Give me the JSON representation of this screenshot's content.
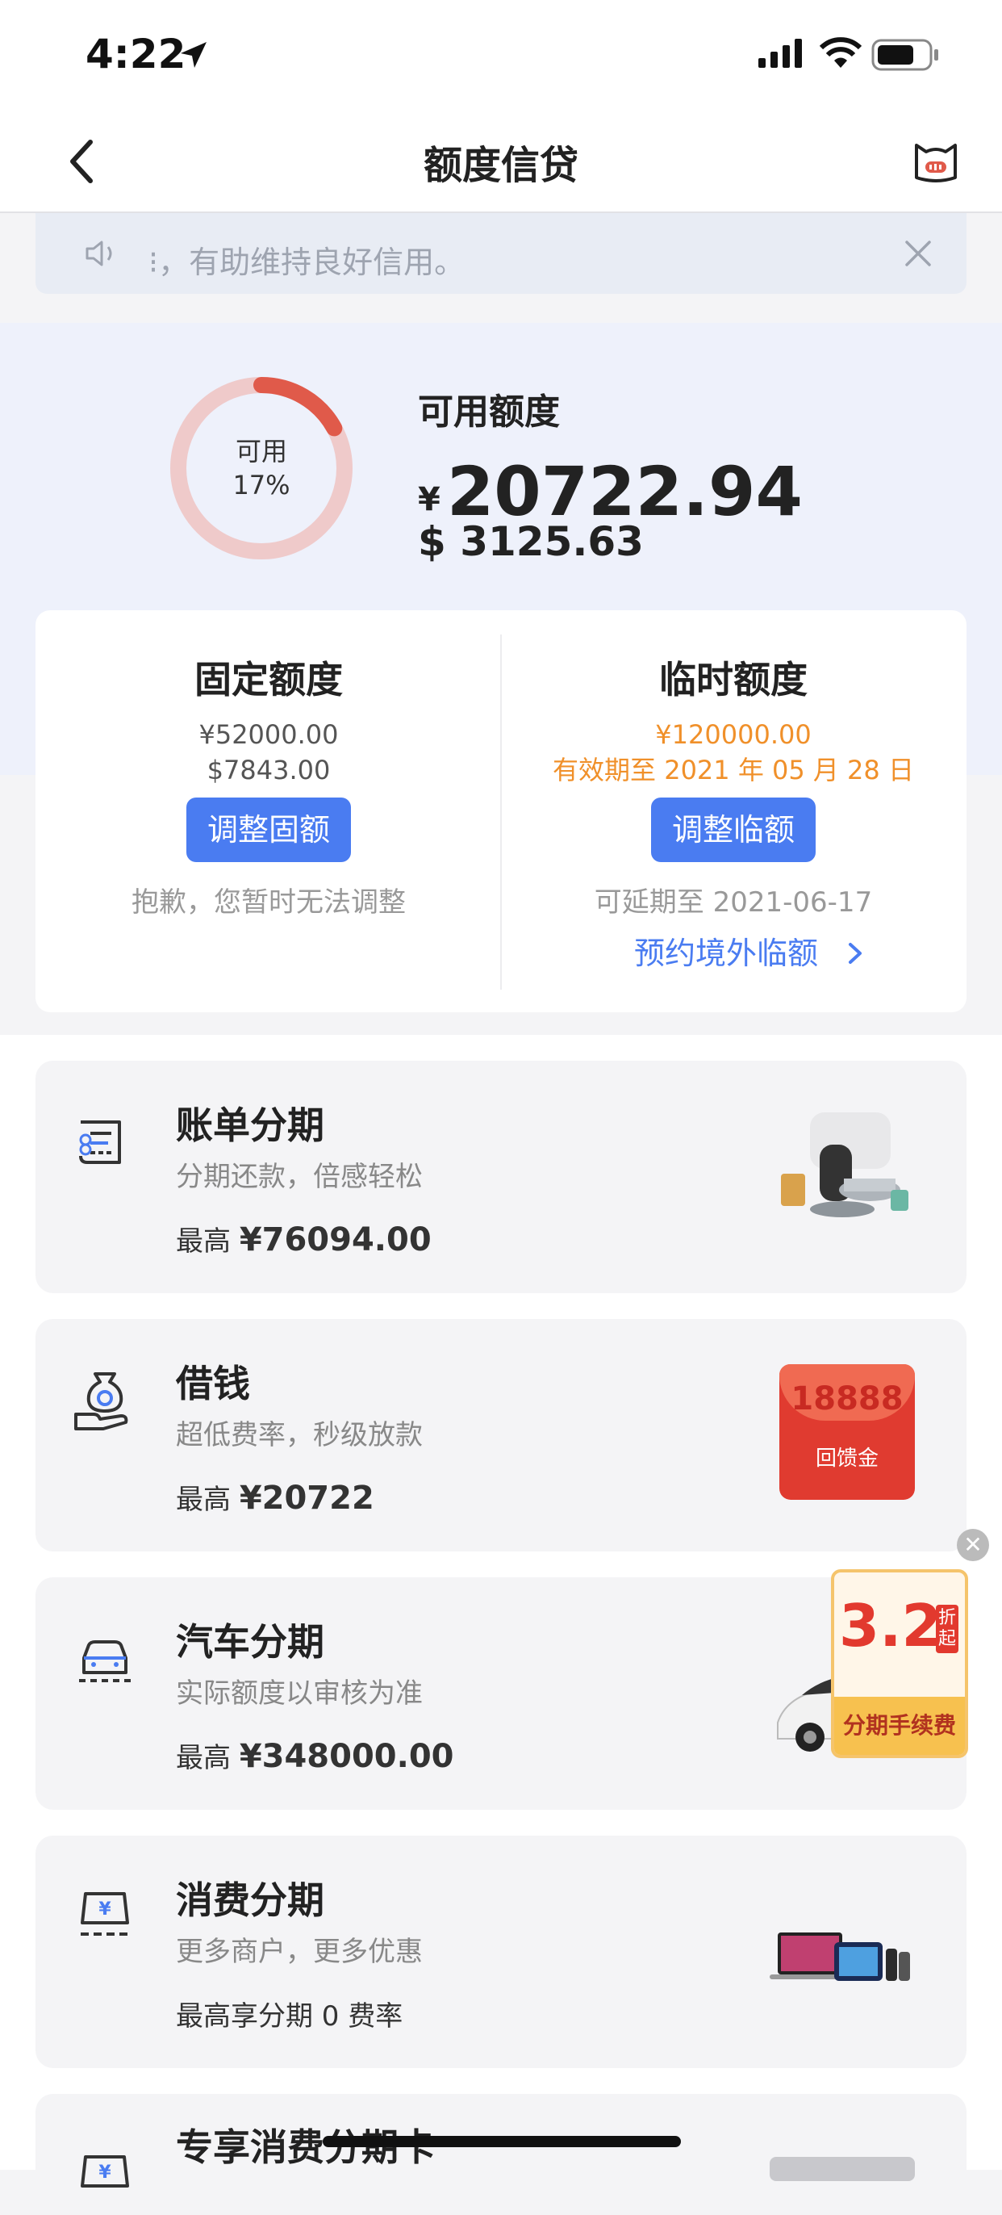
{
  "status_bar": {
    "time": "4:22"
  },
  "header": {
    "title": "额度信贷"
  },
  "notice": {
    "text": "⁝，有助维持良好信用。"
  },
  "summary": {
    "ring_label": "可用",
    "ring_percent": "17%",
    "ring_fraction": 0.17,
    "available_label": "可用额度",
    "cny_symbol": "¥",
    "cny_amount": "20722.94",
    "usd_amount": "$ 3125.63"
  },
  "fixed": {
    "title": "固定额度",
    "cny": "¥52000.00",
    "usd": "$7843.00",
    "button": "调整固额",
    "note": "抱歉，您暂时无法调整"
  },
  "temp": {
    "title": "临时额度",
    "cny": "¥120000.00",
    "validity": "有效期至 2021 年 05 月 28 日",
    "button": "调整临额",
    "note": "可延期至 2021-06-17",
    "link": "预约境外临额"
  },
  "items": [
    {
      "title": "账单分期",
      "subtitle": "分期还款，倍感轻松",
      "prefix": "最高",
      "amount": "¥76094.00"
    },
    {
      "title": "借钱",
      "subtitle": "超低费率，秒级放款",
      "prefix": "最高",
      "amount": "¥20722"
    },
    {
      "title": "汽车分期",
      "subtitle": "实际额度以审核为准",
      "prefix": "最高",
      "amount": "¥348000.00"
    },
    {
      "title": "消费分期",
      "subtitle": "更多商户，更多优惠",
      "prefix": "最高享分期 0 费率",
      "amount": ""
    },
    {
      "title": "专享消费分期卡",
      "subtitle": "",
      "prefix": "",
      "amount": ""
    }
  ],
  "loan_badge": {
    "number": "18888",
    "label": "回馈金"
  },
  "promo": {
    "number": "3.2",
    "tag": "折起",
    "label": "分期手续费"
  },
  "colors": {
    "accent": "#4a7cf1",
    "orange": "#f0902a",
    "ring": "#e05a4a"
  }
}
